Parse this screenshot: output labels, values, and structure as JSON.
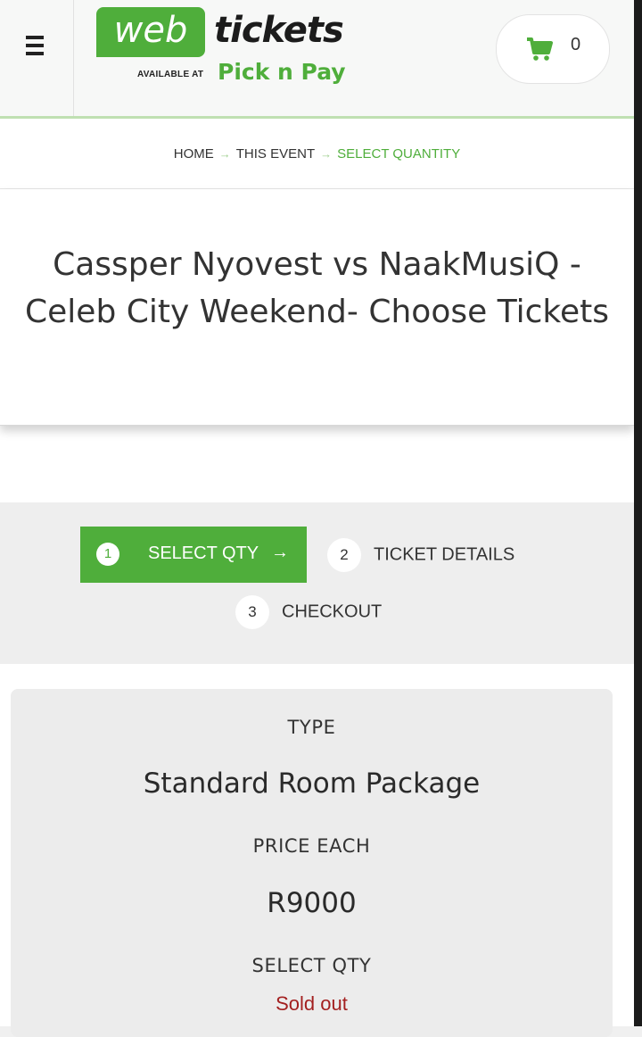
{
  "header": {
    "logo_web": "web",
    "logo_tickets": "tickets",
    "logo_available_at": "AVAILABLE AT",
    "logo_picknpay": "Pick n Pay",
    "cart_count": "0",
    "cart_icon": "shopping-cart-icon",
    "menu_icon": "hamburger-menu-icon"
  },
  "breadcrumb": {
    "items": [
      "HOME",
      "THIS EVENT",
      "SELECT QUANTITY"
    ],
    "separator": "→"
  },
  "event": {
    "title": "Cassper Nyovest vs NaakMusiQ - Celeb City Weekend- Choose Tickets"
  },
  "steps": [
    {
      "num": "1",
      "label": "SELECT QTY",
      "arrow": "→",
      "active": true
    },
    {
      "num": "2",
      "label": "TICKET DETAILS",
      "active": false
    },
    {
      "num": "3",
      "label": "CHECKOUT",
      "active": false
    }
  ],
  "ticket": {
    "type_label": "TYPE",
    "type_value": "Standard Room Package",
    "price_label": "PRICE EACH",
    "price_value": "R9000",
    "qty_label": "SELECT QTY",
    "qty_status": "Sold out"
  },
  "colors": {
    "brand_green": "#4fae3b",
    "sold_out_red": "#a32020"
  }
}
